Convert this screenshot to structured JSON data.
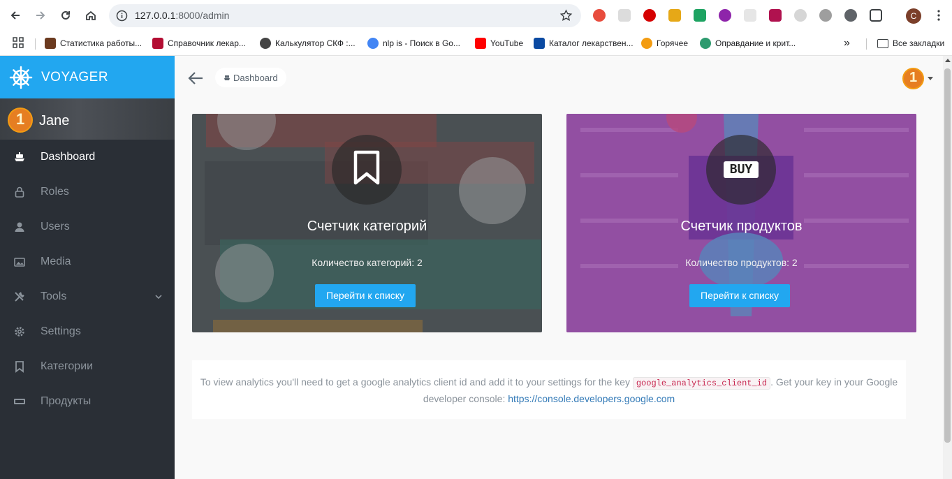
{
  "browser": {
    "url_host": "127.0.0.1",
    "url_rest": ":8000/admin",
    "profile_initial": "C",
    "bookmarks": [
      {
        "label": "Статистика работы...",
        "color": "#6b3a1f"
      },
      {
        "label": "Справочник лекар...",
        "color": "#b30d33"
      },
      {
        "label": "Калькулятор СКФ :...",
        "color": "#444444"
      },
      {
        "label": "nlp is - Поиск в Go...",
        "color": "#4285f4"
      },
      {
        "label": "YouTube",
        "color": "#ff0000"
      },
      {
        "label": "Каталог лекарствен...",
        "color": "#0b4aa2"
      },
      {
        "label": "Горячее",
        "color": "#f39c12"
      },
      {
        "label": "Оправдание и крит...",
        "color": "#2e9b6f"
      }
    ],
    "more_bookmarks": "»",
    "all_bookmarks": "Все закладки"
  },
  "brand": {
    "name": "VOYAGER",
    "color": "#22a7f0"
  },
  "user": {
    "name": "Jane",
    "avatar_text": "1"
  },
  "sidebar": {
    "items": [
      {
        "label": "Dashboard",
        "icon": "boat-icon",
        "active": true
      },
      {
        "label": "Roles",
        "icon": "lock-icon"
      },
      {
        "label": "Users",
        "icon": "person-icon"
      },
      {
        "label": "Media",
        "icon": "images-icon"
      },
      {
        "label": "Tools",
        "icon": "tools-icon",
        "has_children": true
      },
      {
        "label": "Settings",
        "icon": "gear-icon"
      },
      {
        "label": "Категории",
        "icon": "bookmark-icon"
      },
      {
        "label": "Продукты",
        "icon": "buy-icon"
      }
    ]
  },
  "header": {
    "breadcrumb": "Dashboard",
    "avatar_text": "1"
  },
  "cards": [
    {
      "title": "Счетчик категорий",
      "count_text": "Количество категорий: 2",
      "button": "Перейти к списку",
      "icon": "bookmark-icon"
    },
    {
      "title": "Счетчик продуктов",
      "count_text": "Количество продуктов: 2",
      "button": "Перейти к списку",
      "icon": "buy-icon",
      "icon_text": "BUY"
    }
  ],
  "notice": {
    "text_before": "To view analytics you'll need to get a google analytics client id and add it to your settings for the key",
    "code": "google_analytics_client_id",
    "text_after": ". Get your key in your Google developer console:",
    "link": "https://console.developers.google.com"
  }
}
